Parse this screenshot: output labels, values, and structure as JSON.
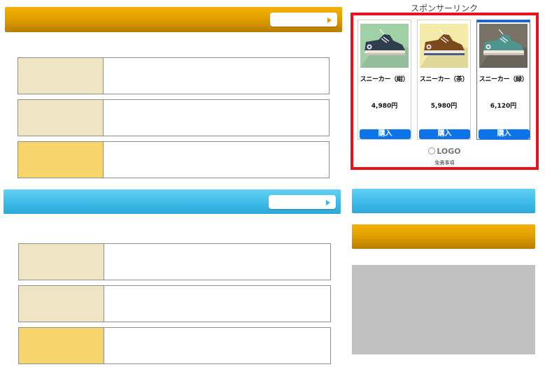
{
  "sponsor": {
    "title": "スポンサーリンク",
    "products": [
      {
        "name": "スニーカー（紺）",
        "price": "4,980円",
        "buy_label": "購入",
        "image_bg": "#9fd0a6",
        "shoe_color": "#2f3e4e"
      },
      {
        "name": "スニーカー（茶）",
        "price": "5,980円",
        "buy_label": "購入",
        "image_bg": "#f3eba7",
        "shoe_color": "#7a4a1d"
      },
      {
        "name": "スニーカー（緑）",
        "price": "6,120円",
        "buy_label": "購入",
        "image_bg": "#777166",
        "shoe_color": "#4f948e"
      }
    ],
    "logo_text": "LOGO",
    "disclaimer": "免責事項"
  },
  "colors": {
    "orange_banner": "#e3a100",
    "blue_banner": "#3fbbe8",
    "ad_border": "#e8121e",
    "buy_button": "#0c74e8",
    "placeholder_gray": "#c1c1c1"
  },
  "icons": {
    "more_arrow": "play-triangle-icon",
    "logo_mark": "circle-icon"
  }
}
